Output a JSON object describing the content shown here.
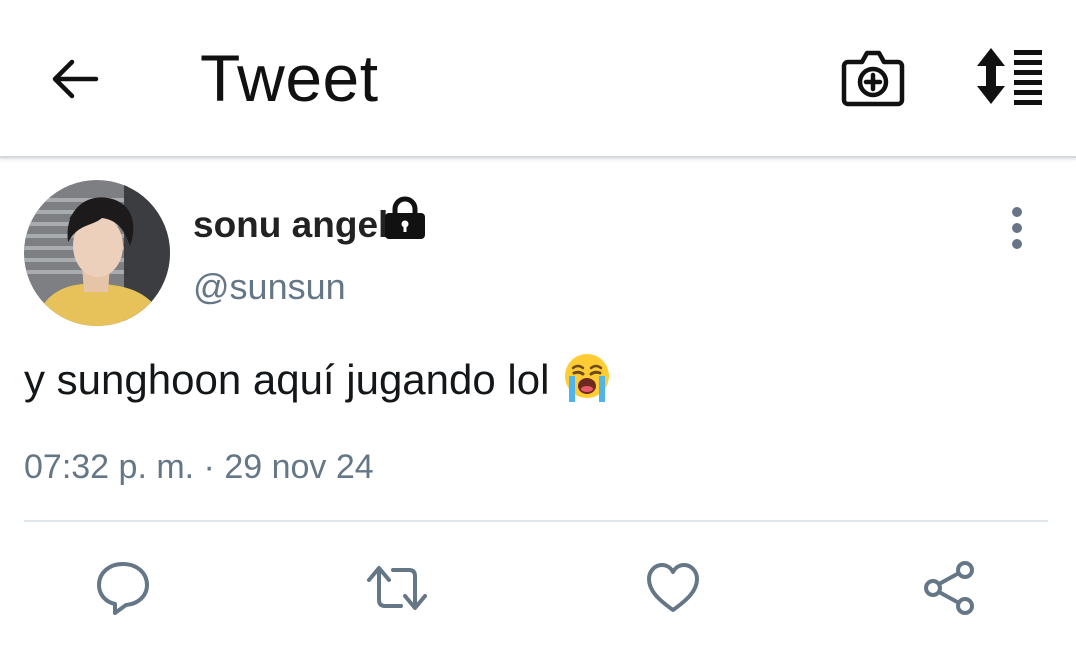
{
  "header": {
    "title": "Tweet",
    "icons": {
      "back": "back-arrow-icon",
      "camera": "camera-plus-icon",
      "sort": "sort-list-icon"
    }
  },
  "tweet": {
    "author": {
      "name": "sonu angel",
      "handle": "@sunsun",
      "protected": true
    },
    "text": "y sunghoon aquí jugando lol",
    "emoji": "loudly-crying-face",
    "timestamp": "07:32 p. m. · 29 nov 24"
  },
  "actions": [
    "reply-icon",
    "retweet-icon",
    "like-icon",
    "share-icon"
  ],
  "colors": {
    "text": "#14171a",
    "secondary": "#657786",
    "divider": "#e1e8ed",
    "icon": "#657786"
  }
}
